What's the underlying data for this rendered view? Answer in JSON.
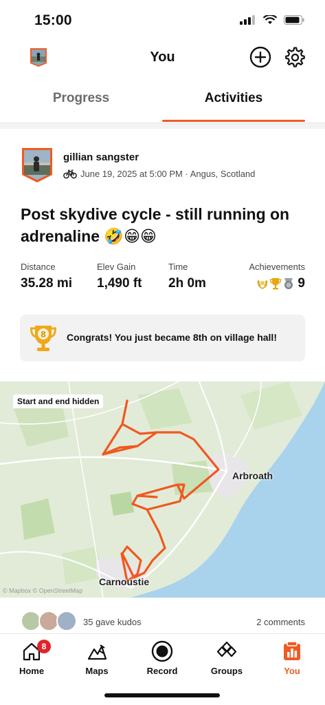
{
  "status": {
    "time": "15:00"
  },
  "header": {
    "title": "You",
    "add_icon": "plus-circle-icon",
    "settings_icon": "gear-icon"
  },
  "tabs": [
    {
      "label": "Progress",
      "active": false
    },
    {
      "label": "Activities",
      "active": true
    }
  ],
  "activity": {
    "athlete": "gillian sangster",
    "sport_icon": "bike-icon",
    "meta": "June 19, 2025 at 5:00 PM · Angus, Scotland",
    "title": "Post skydive cycle - still running on adrenaline 🤣😁😁",
    "stats": [
      {
        "label": "Distance",
        "value": "35.28 mi"
      },
      {
        "label": "Elev Gain",
        "value": "1,490 ft"
      },
      {
        "label": "Time",
        "value": "2h 0m"
      }
    ],
    "achievements": {
      "label": "Achievements",
      "count": "9"
    },
    "congrats": {
      "rank": "8",
      "text": "Congrats! You just became 8th on village hall!"
    },
    "map": {
      "privacy_label": "Start and end hidden",
      "towns": [
        "Arbroath",
        "Carnoustie"
      ],
      "attribution": "© Mapbox © OpenStreetMap"
    },
    "kudos": "35 gave kudos",
    "comments": "2 comments"
  },
  "tabbar": {
    "items": [
      {
        "label": "Home",
        "icon": "home-icon",
        "badge": "8"
      },
      {
        "label": "Maps",
        "icon": "maps-icon"
      },
      {
        "label": "Record",
        "icon": "record-icon"
      },
      {
        "label": "Groups",
        "icon": "groups-icon"
      },
      {
        "label": "You",
        "icon": "you-icon",
        "active": true
      }
    ]
  },
  "colors": {
    "accent": "#f05a22",
    "badge": "#e0242c",
    "map_land": "#e3ecd9",
    "map_sea": "#a9d2ec",
    "route": "#f0581f"
  }
}
